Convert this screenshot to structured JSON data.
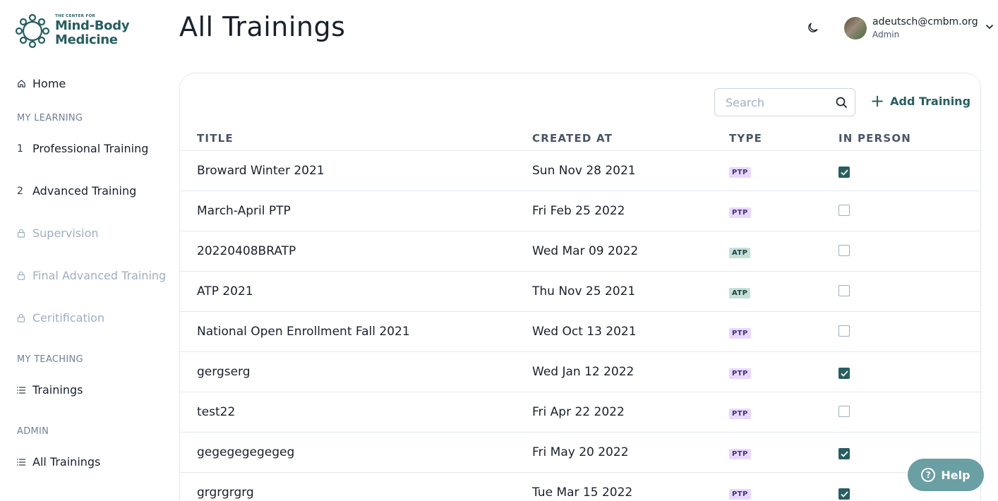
{
  "brand": {
    "line1": "THE CENTER FOR",
    "line2": "Mind-Body",
    "line3": "Medicine"
  },
  "page_title": "All Trainings",
  "user": {
    "email": "adeutsch@cmbm.org",
    "role": "Admin"
  },
  "sidebar": {
    "home": "Home",
    "sections": {
      "learning": "MY LEARNING",
      "teaching": "MY TEACHING",
      "admin": "ADMIN"
    },
    "learning_items": [
      {
        "index": "1",
        "label": "Professional Training",
        "locked": false
      },
      {
        "index": "2",
        "label": "Advanced Training",
        "locked": false
      },
      {
        "label": "Supervision",
        "locked": true
      },
      {
        "label": "Final Advanced Training",
        "locked": true
      },
      {
        "label": "Ceritification",
        "locked": true
      }
    ],
    "teaching_items": [
      {
        "label": "Trainings"
      }
    ],
    "admin_items": [
      {
        "label": "All Trainings"
      }
    ]
  },
  "search": {
    "placeholder": "Search",
    "value": ""
  },
  "add_button": "Add Training",
  "table": {
    "columns": [
      "TITLE",
      "CREATED AT",
      "TYPE",
      "IN PERSON"
    ],
    "rows": [
      {
        "title": "Broward Winter 2021",
        "created": "Sun Nov 28 2021",
        "type": "PTP",
        "in_person": true
      },
      {
        "title": "March-April PTP",
        "created": "Fri Feb 25 2022",
        "type": "PTP",
        "in_person": false
      },
      {
        "title": "20220408BRATP",
        "created": "Wed Mar 09 2022",
        "type": "ATP",
        "in_person": false
      },
      {
        "title": "ATP 2021",
        "created": "Thu Nov 25 2021",
        "type": "ATP",
        "in_person": false
      },
      {
        "title": "National Open Enrollment Fall 2021",
        "created": "Wed Oct 13 2021",
        "type": "PTP",
        "in_person": false
      },
      {
        "title": "gergserg",
        "created": "Wed Jan 12 2022",
        "type": "PTP",
        "in_person": true
      },
      {
        "title": "test22",
        "created": "Fri Apr 22 2022",
        "type": "PTP",
        "in_person": false
      },
      {
        "title": "gegegegegegeg",
        "created": "Fri May 20 2022",
        "type": "PTP",
        "in_person": true
      },
      {
        "title": "grgrgrgrg",
        "created": "Tue Mar 15 2022",
        "type": "PTP",
        "in_person": true
      }
    ]
  },
  "help_button": "Help",
  "colors": {
    "accent": "#285e61",
    "ptp_badge": "#e9d8fd",
    "atp_badge": "#c6e0d8",
    "help": "#6a9fa4"
  }
}
